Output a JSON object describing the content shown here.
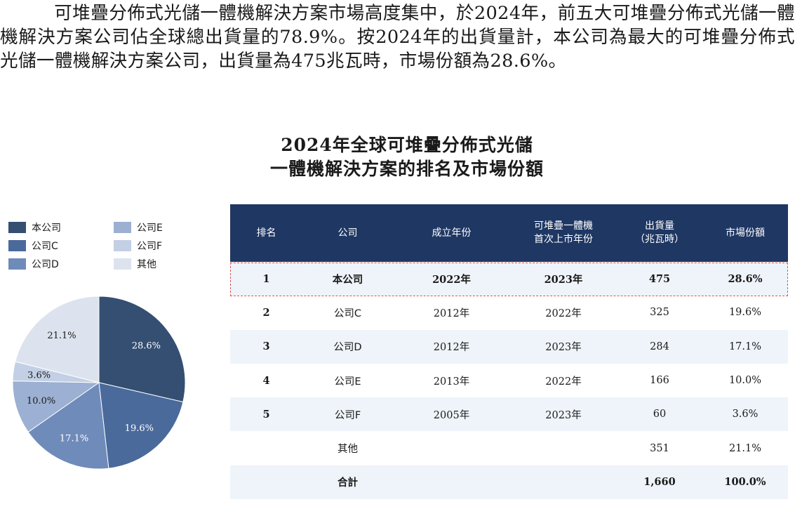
{
  "paragraph": {
    "text": "可堆疊分佈式光儲一體機解決方案市場高度集中，於2024年，前五大可堆疊分佈式光儲一體機解決方案公司佔全球總出貨量的78.9%。按2024年的出貨量計，本公司為最大的可堆疊分佈式光儲一體機解決方案公司，出貨量為475兆瓦時，市場份額為28.6%。"
  },
  "figure_title": {
    "line1": "2024年全球可堆疊分佈式光儲",
    "line2": "一體機解決方案的排名及市場份額"
  },
  "legend": [
    {
      "label": "本公司",
      "color": "#344f72"
    },
    {
      "label": "公司C",
      "color": "#4a6a9c"
    },
    {
      "label": "公司D",
      "color": "#6f8bba"
    },
    {
      "label": "公司E",
      "color": "#9bb0d2"
    },
    {
      "label": "公司F",
      "color": "#c3cfe4"
    },
    {
      "label": "其他",
      "color": "#dde3ee"
    }
  ],
  "table": {
    "headers": [
      "排名",
      "公司",
      "成立年份",
      "可堆疊一體機\n首次上市年份",
      "出貨量\n（兆瓦時）",
      "市場份額"
    ],
    "rows": [
      {
        "rank": "1",
        "company": "本公司",
        "founded": "2022年",
        "first_launch": "2023年",
        "shipments": "475",
        "share": "28.6%"
      },
      {
        "rank": "2",
        "company": "公司C",
        "founded": "2012年",
        "first_launch": "2022年",
        "shipments": "325",
        "share": "19.6%"
      },
      {
        "rank": "3",
        "company": "公司D",
        "founded": "2012年",
        "first_launch": "2023年",
        "shipments": "284",
        "share": "17.1%"
      },
      {
        "rank": "4",
        "company": "公司E",
        "founded": "2013年",
        "first_launch": "2022年",
        "shipments": "166",
        "share": "10.0%"
      },
      {
        "rank": "5",
        "company": "公司F",
        "founded": "2005年",
        "first_launch": "2023年",
        "shipments": "60",
        "share": "3.6%"
      },
      {
        "rank": "",
        "company": "其他",
        "founded": "",
        "first_launch": "",
        "shipments": "351",
        "share": "21.1%"
      },
      {
        "rank": "",
        "company": "合計",
        "founded": "",
        "first_launch": "",
        "shipments": "1,660",
        "share": "100.0%"
      }
    ]
  },
  "chart_data": [
    {
      "type": "pie",
      "title": "2024年全球可堆疊分佈式光儲一體機解決方案的排名及市場份額",
      "categories": [
        "本公司",
        "公司C",
        "公司D",
        "公司E",
        "公司F",
        "其他"
      ],
      "values": [
        28.6,
        19.6,
        17.1,
        10.0,
        3.6,
        21.1
      ],
      "data_labels": [
        "28.6%",
        "19.6%",
        "17.1%",
        "10.0%",
        "3.6%",
        "21.1%"
      ],
      "colors": [
        "#344f72",
        "#4a6a9c",
        "#6f8bba",
        "#9bb0d2",
        "#c3cfe4",
        "#dde3ee"
      ],
      "label_colors": [
        "#ffffff",
        "#ffffff",
        "#ffffff",
        "#1a1a1a",
        "#1a1a1a",
        "#1a1a1a"
      ],
      "start": "12 o'clock",
      "direction": "clockwise",
      "legend_position": "top"
    },
    {
      "type": "table",
      "columns": [
        "排名",
        "公司",
        "成立年份",
        "可堆疊一體機首次上市年份",
        "出貨量（兆瓦時）",
        "市場份額"
      ],
      "highlighted_row": "本公司"
    }
  ]
}
